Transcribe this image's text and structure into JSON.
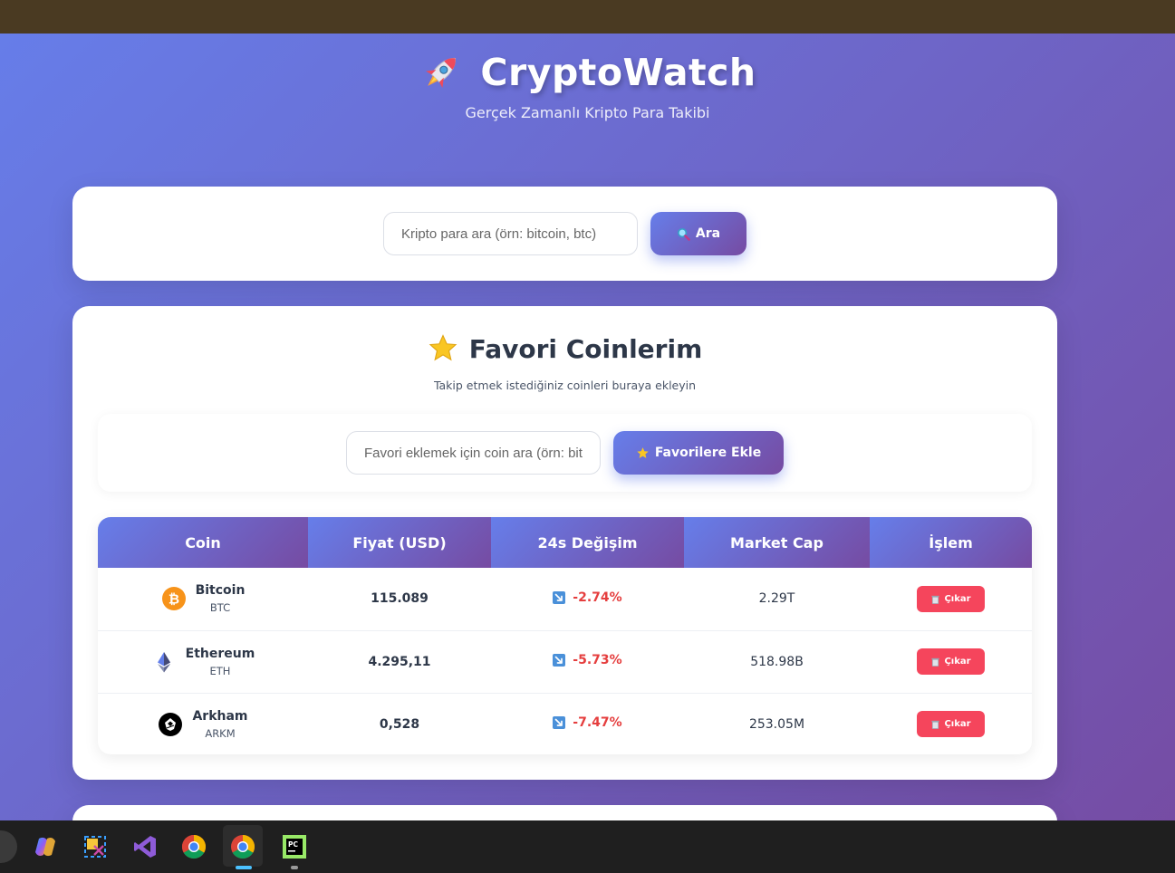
{
  "header": {
    "title": "CryptoWatch",
    "subtitle": "Gerçek Zamanlı Kripto Para Takibi"
  },
  "search": {
    "placeholder": "Kripto para ara (örn: bitcoin, btc)",
    "value": "",
    "button_label": "Ara"
  },
  "favorites": {
    "title": "Favori Coinlerim",
    "description": "Takip etmek istediğiniz coinleri buraya ekleyin",
    "add_placeholder": "Favori eklemek için coin ara (örn: bit",
    "add_value": "",
    "add_button_label": "Favorilere Ekle"
  },
  "table": {
    "columns": [
      "Coin",
      "Fiyat (USD)",
      "24s Değişim",
      "Market Cap",
      "İşlem"
    ],
    "rows": [
      {
        "name": "Bitcoin",
        "symbol": "BTC",
        "price": "115.089",
        "change": "-2.74%",
        "market_cap": "2.29T",
        "action": "Çıkar",
        "icon": "bitcoin-icon",
        "icon_color": "#f7931a"
      },
      {
        "name": "Ethereum",
        "symbol": "ETH",
        "price": "4.295,11",
        "change": "-5.73%",
        "market_cap": "518.98B",
        "action": "Çıkar",
        "icon": "ethereum-icon",
        "icon_color": "#627eea"
      },
      {
        "name": "Arkham",
        "symbol": "ARKM",
        "price": "0,528",
        "change": "-7.47%",
        "market_cap": "253.05M",
        "action": "Çıkar",
        "icon": "arkham-icon",
        "icon_color": "#000000"
      }
    ]
  },
  "taskbar": {
    "apps": [
      "copilot-icon",
      "snipping-tool-icon",
      "visual-studio-icon",
      "chrome-icon",
      "chrome-icon",
      "pycharm-icon"
    ]
  },
  "colors": {
    "accent_start": "#667eea",
    "accent_end": "#764ba2",
    "negative": "#e53e3e",
    "remove_button": "#f5455c"
  }
}
